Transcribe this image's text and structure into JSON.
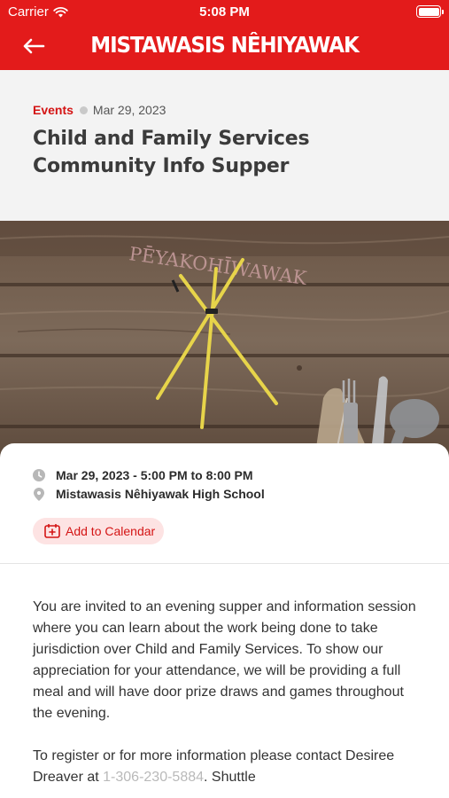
{
  "status_bar": {
    "carrier": "Carrier",
    "time": "5:08 PM"
  },
  "nav": {
    "title": "MISTAWASIS NÊHIYAWAK",
    "back_icon": "arrow-left-icon"
  },
  "post": {
    "category": "Events",
    "date": "Mar 29, 2023",
    "title": "Child and Family Services Community Info Supper"
  },
  "hero": {
    "logo_text": "PĒYAKOHĪWAWAK"
  },
  "event": {
    "datetime": "Mar 29, 2023 - 5:00 PM to 8:00 PM",
    "location": "Mistawasis Nêhiyawak High School",
    "add_to_calendar": "Add to Calendar"
  },
  "description": {
    "paragraph1": "You are invited to an evening supper and information session where you can learn about the work being done to take jurisdiction over Child and Family Services. To show our appreciation for your attendance, we will be providing a full meal and will have door prize draws and games throughout the evening.",
    "paragraph2_start": "To register or for more information please contact Desiree Dreaver at ",
    "phone": "1-306-230-5884",
    "paragraph2_end": ". Shuttle"
  },
  "colors": {
    "brand_red": "#e31b1b",
    "accent_text_red": "#d41414",
    "pill_bg": "#fde3e3"
  }
}
